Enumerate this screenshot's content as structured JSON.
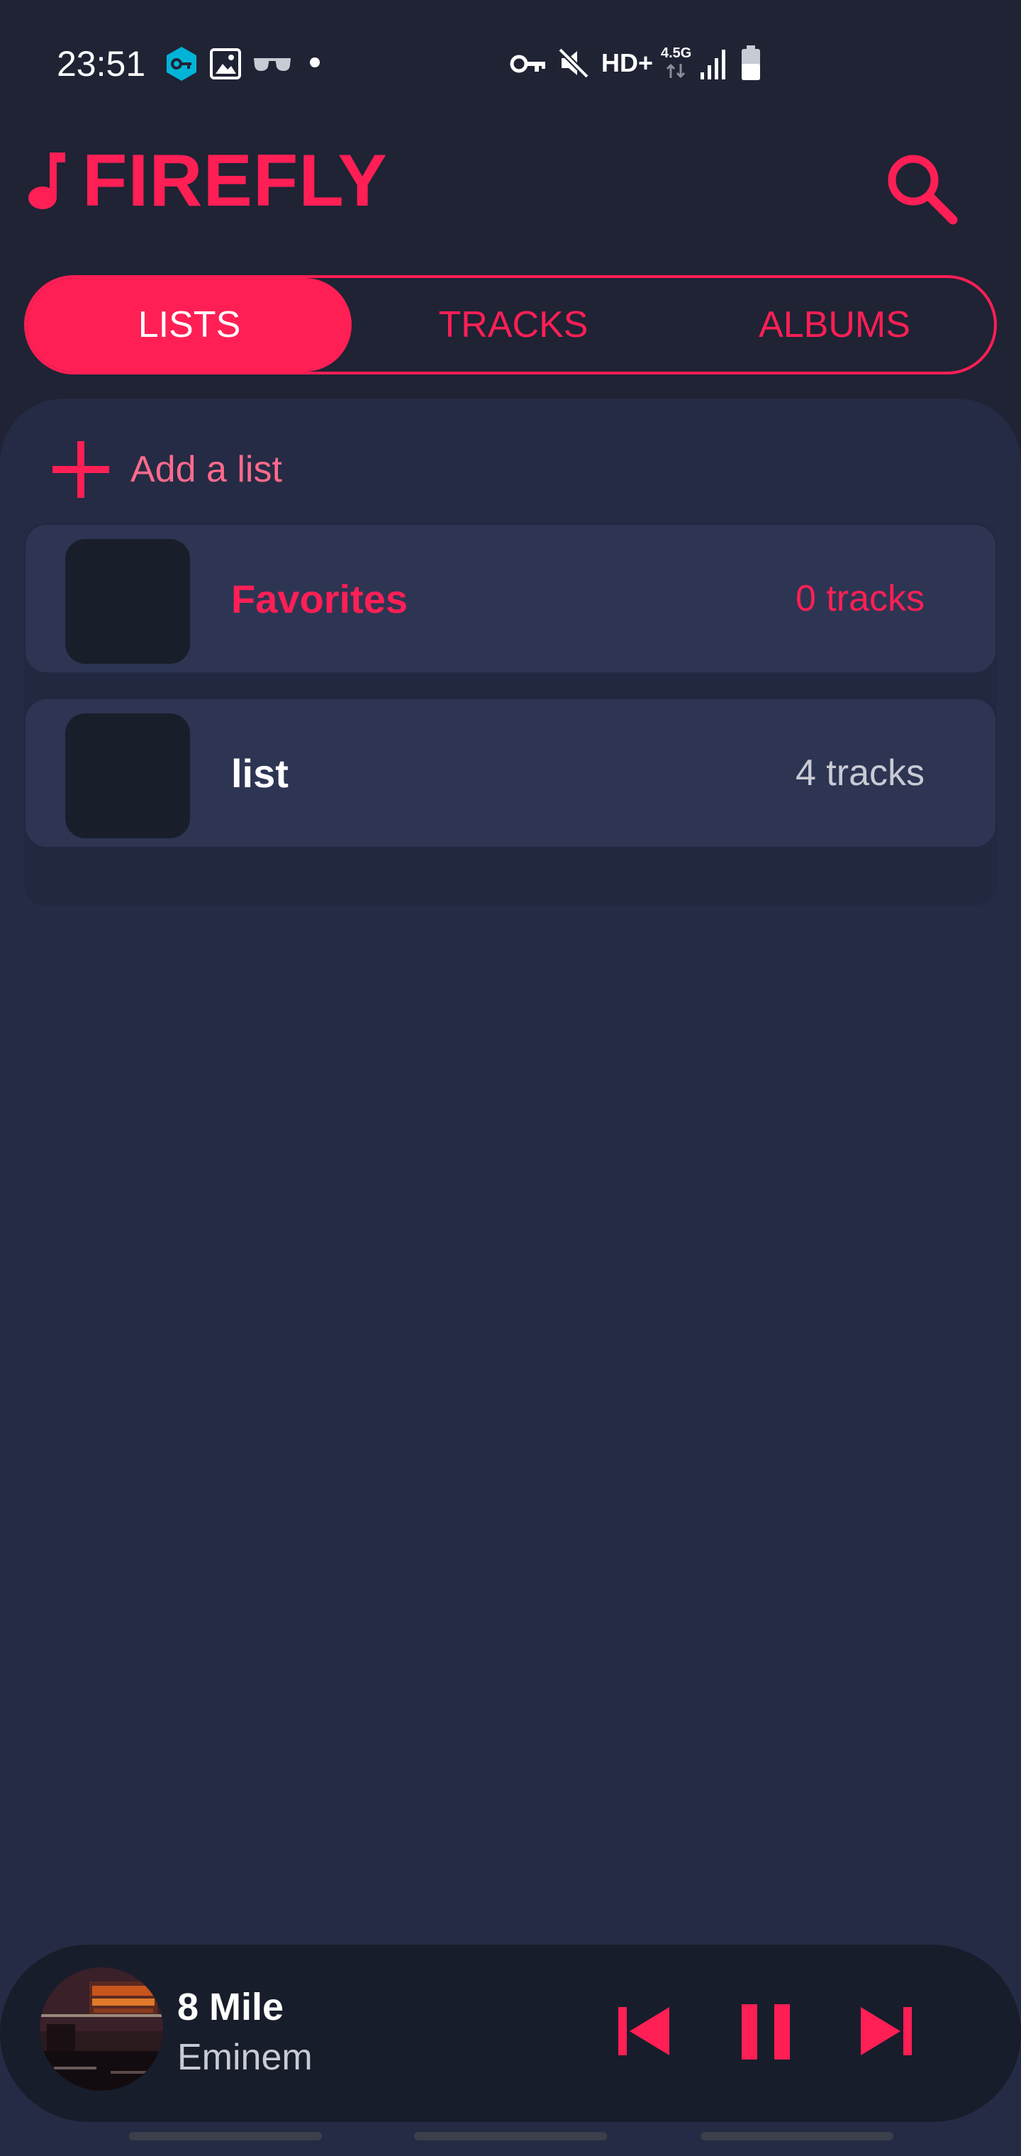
{
  "status_bar": {
    "time": "23:51",
    "left_icons": [
      "vpn-key-badge-icon",
      "gallery-icon",
      "incognito-glasses-icon",
      "notification-dot-icon"
    ],
    "right_icons": [
      "key-icon",
      "mute-icon",
      "signal-bars-icon",
      "battery-icon"
    ],
    "network_label": "HD+",
    "network_type": "4.5G"
  },
  "header": {
    "title": "FIREFLY",
    "logo_icon": "music-note-icon",
    "search_icon": "search-icon"
  },
  "tabs": [
    {
      "label": "LISTS",
      "active": true
    },
    {
      "label": "TRACKS",
      "active": false
    },
    {
      "label": "ALBUMS",
      "active": false
    }
  ],
  "main": {
    "add_label": "Add a list",
    "lists": [
      {
        "name": "Favorites",
        "count": "0 tracks",
        "highlighted": true
      },
      {
        "name": "list",
        "count": "4 tracks",
        "highlighted": false
      }
    ]
  },
  "player": {
    "title": "8 Mile",
    "artist": "Eminem",
    "controls": [
      "previous-icon",
      "pause-icon",
      "next-icon"
    ]
  },
  "colors": {
    "accent": "#ff1f55",
    "background": "#1f2334",
    "panel": "#252b44",
    "card": "#2d3553",
    "player": "#181d2b"
  }
}
